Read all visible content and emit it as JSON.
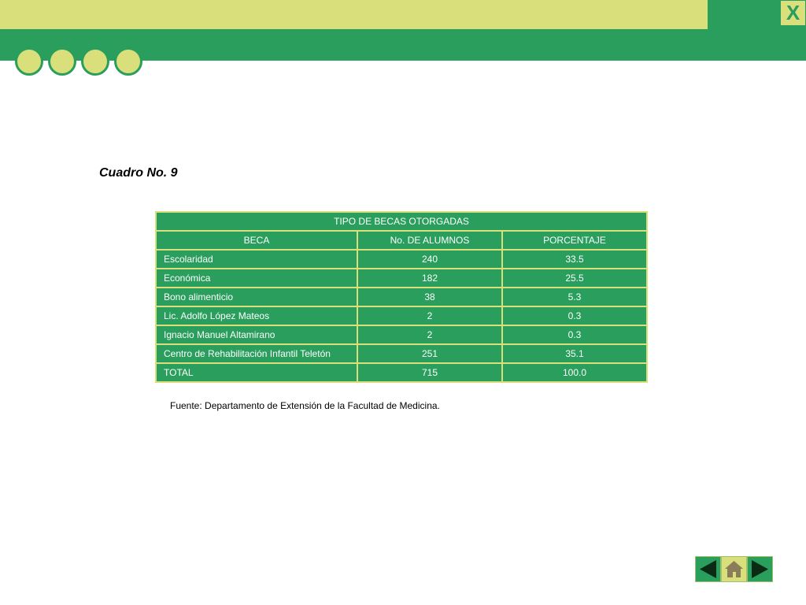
{
  "window": {
    "close_label": "X"
  },
  "caption": "Cuadro No. 9",
  "table": {
    "title": "TIPO DE BECAS OTORGADAS",
    "headers": [
      "BECA",
      "No. DE ALUMNOS",
      "PORCENTAJE"
    ],
    "rows": [
      [
        "Escolaridad",
        "240",
        "33.5"
      ],
      [
        "Económica",
        "182",
        "25.5"
      ],
      [
        "Bono alimenticio",
        "38",
        "5.3"
      ],
      [
        "Lic. Adolfo López Mateos",
        "2",
        "0.3"
      ],
      [
        "Ignacio Manuel Altamirano",
        "2",
        "0.3"
      ],
      [
        "Centro de Rehabilitación Infantil Teletón",
        "251",
        "35.1"
      ],
      [
        "TOTAL",
        "715",
        "100.0"
      ]
    ]
  },
  "source": "Fuente: Departamento de Extensión de la Facultad de Medicina.",
  "nav": {
    "icons": [
      "previous-arrow-icon",
      "home-icon",
      "next-arrow-icon"
    ]
  },
  "colors": {
    "green": "#2a9e5c",
    "lime": "#d9df7b"
  }
}
